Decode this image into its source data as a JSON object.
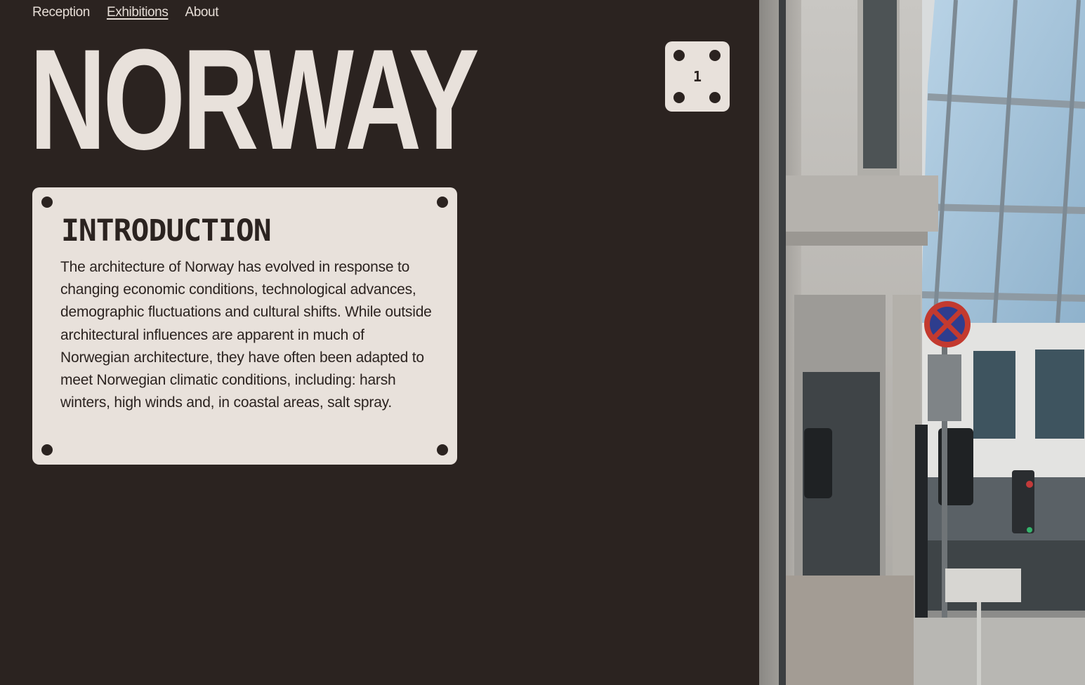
{
  "nav": {
    "items": [
      {
        "label": "Reception",
        "active": false
      },
      {
        "label": "Exhibitions",
        "active": true
      },
      {
        "label": "About",
        "active": false
      }
    ]
  },
  "header": {
    "title": "NORWAY"
  },
  "counter": {
    "value": "1"
  },
  "intro": {
    "heading": "INTRODUCTION",
    "body": "The architecture of Norway has evolved in response to changing economic conditions, technological advances, demographic fluctuations and cultural shifts. While outside architectural influences are apparent in much of Norwegian architecture, they have often been adapted to meet Norwegian climatic conditions, including: harsh winters, high winds and, in coastal areas, salt spray."
  },
  "photo": {
    "description_icon": "street-photo"
  },
  "colors": {
    "background": "#2b2320",
    "panel": "#e8e1db",
    "text_light": "#e6ddd6",
    "text_dark": "#2b2320"
  }
}
